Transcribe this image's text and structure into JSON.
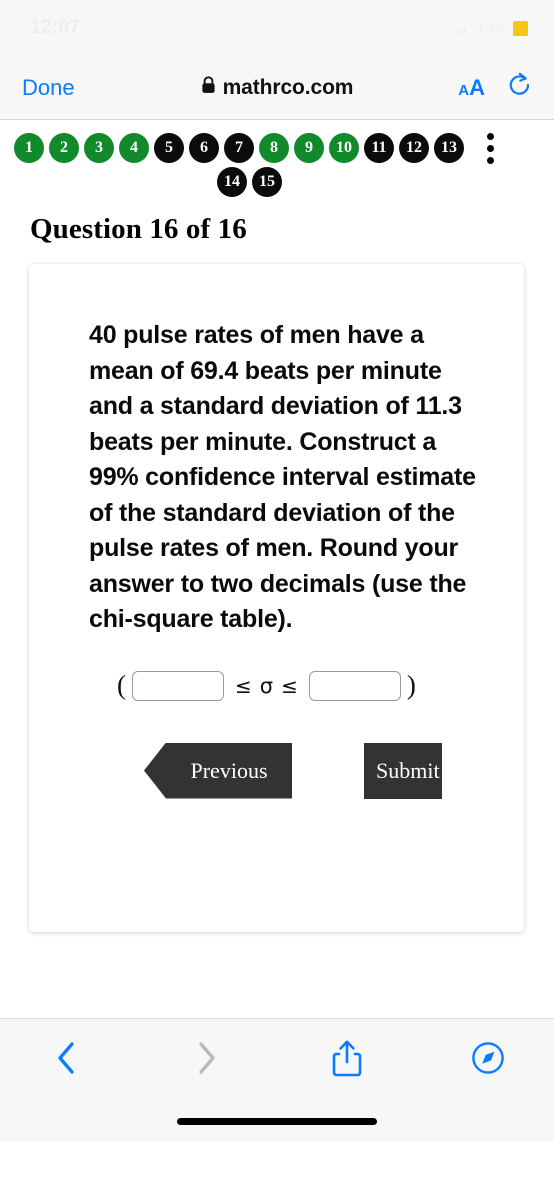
{
  "status_bar": {
    "time": "12:07",
    "network": "LTE",
    "signal_icon": "signal-bars-icon",
    "battery_icon": "battery-icon"
  },
  "nav_bar": {
    "done_label": "Done",
    "lock_icon": "lock-icon",
    "url": "mathrco.com",
    "text_size_label_small": "A",
    "text_size_label_large": "A",
    "text_size_icon": "text-size-icon",
    "reload_icon": "reload-icon"
  },
  "question_nav": {
    "kebab_icon": "more-options-icon",
    "colors": {
      "answered": "#128a2c",
      "unanswered": "#0b0b0b"
    },
    "row1": [
      {
        "num": "1",
        "state": "answered"
      },
      {
        "num": "2",
        "state": "answered"
      },
      {
        "num": "3",
        "state": "answered"
      },
      {
        "num": "4",
        "state": "answered"
      },
      {
        "num": "5",
        "state": "unanswered"
      },
      {
        "num": "6",
        "state": "unanswered"
      },
      {
        "num": "7",
        "state": "unanswered"
      },
      {
        "num": "8",
        "state": "answered"
      },
      {
        "num": "9",
        "state": "answered"
      },
      {
        "num": "10",
        "state": "answered"
      },
      {
        "num": "11",
        "state": "unanswered"
      },
      {
        "num": "12",
        "state": "unanswered"
      },
      {
        "num": "13",
        "state": "unanswered"
      }
    ],
    "row2": [
      {
        "num": "14",
        "state": "unanswered"
      },
      {
        "num": "15",
        "state": "unanswered"
      }
    ]
  },
  "page_title": "Question 16 of 16",
  "question": {
    "text": "40 pulse rates of men have a mean of 69.4 beats per minute and a standard deviation of 11.3 beats per minute. Construct a 99% confidence interval estimate of the standard deviation of the pulse rates of men. Round your answer to two decimals (use the chi-square table)."
  },
  "answer": {
    "open_paren": "(",
    "close_paren": ")",
    "lower_value": "",
    "upper_value": "",
    "lower_placeholder": "",
    "upper_placeholder": "",
    "left_operator": "≤",
    "symbol": "σ",
    "right_operator": "≤"
  },
  "buttons": {
    "previous_label": "Previous",
    "submit_label": "Submit"
  },
  "toolbar": {
    "back_icon": "chevron-left-icon",
    "forward_icon": "chevron-right-icon",
    "share_icon": "share-icon",
    "tabs_icon": "safari-compass-icon",
    "back_enabled": true,
    "forward_enabled": false
  }
}
